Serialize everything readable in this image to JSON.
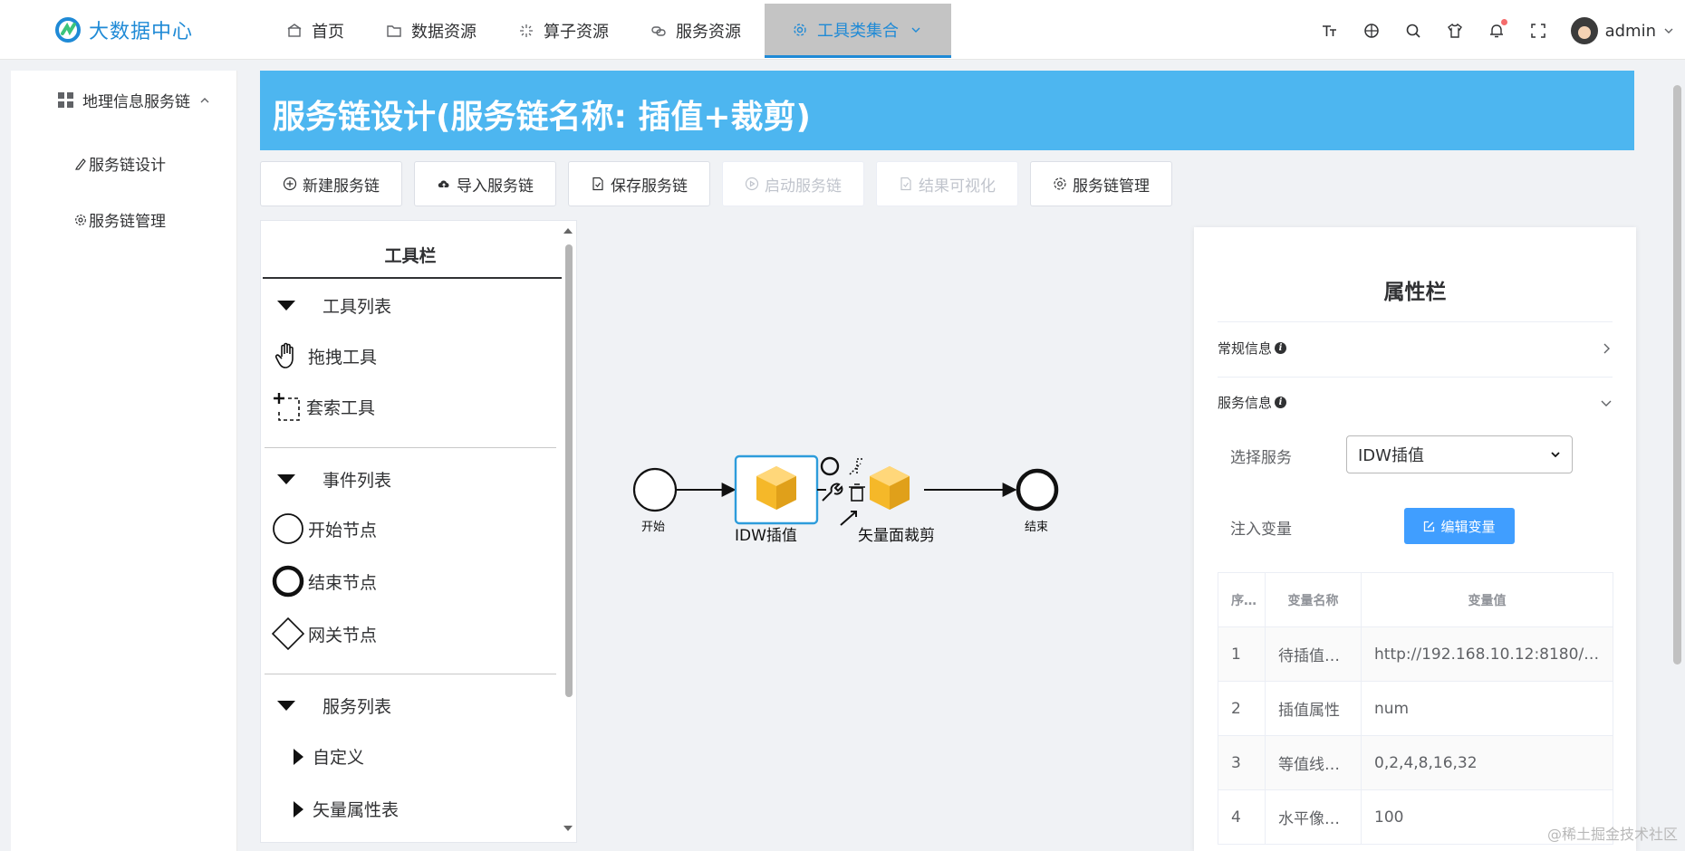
{
  "app": {
    "title": "大数据中心"
  },
  "nav": {
    "items": [
      {
        "label": "首页",
        "icon": "home-icon"
      },
      {
        "label": "数据资源",
        "icon": "folder-icon"
      },
      {
        "label": "算子资源",
        "icon": "sparkle-icon"
      },
      {
        "label": "服务资源",
        "icon": "link-icon"
      },
      {
        "label": "工具类集合",
        "icon": "gear-icon",
        "active": true
      }
    ],
    "user": "admin"
  },
  "sidebar": {
    "group": "地理信息服务链",
    "items": [
      {
        "label": "服务链设计",
        "icon": "pen-icon"
      },
      {
        "label": "服务链管理",
        "icon": "gear-icon"
      }
    ]
  },
  "banner": {
    "title": "服务链设计(服务链名称: 插值+裁剪)"
  },
  "toolbar": {
    "buttons": [
      {
        "label": "新建服务链",
        "icon": "plus-circle-icon",
        "disabled": false
      },
      {
        "label": "导入服务链",
        "icon": "cloud-upload-icon",
        "disabled": false
      },
      {
        "label": "保存服务链",
        "icon": "document-check-icon",
        "disabled": false
      },
      {
        "label": "启动服务链",
        "icon": "play-icon",
        "disabled": true
      },
      {
        "label": "结果可视化",
        "icon": "document-icon",
        "disabled": true
      },
      {
        "label": "服务链管理",
        "icon": "gear-icon",
        "disabled": false
      }
    ]
  },
  "palette": {
    "title": "工具栏",
    "sections": {
      "tools": "工具列表",
      "drag": "拖拽工具",
      "lasso": "套索工具",
      "events": "事件列表",
      "start": "开始节点",
      "end": "结束节点",
      "gateway": "网关节点",
      "services": "服务列表",
      "custom": "自定义",
      "vector_attr": "矢量属性表"
    }
  },
  "diagram": {
    "start_label": "开始",
    "end_label": "结束",
    "task1_label": "IDW插值",
    "task2_label": "矢量面裁剪"
  },
  "props": {
    "title": "属性栏",
    "general": "常规信息",
    "service_info": "服务信息",
    "select_label": "选择服务",
    "select_value": "IDW插值",
    "inject_label": "注入变量",
    "edit_button": "编辑变量",
    "table": {
      "headers": [
        "序号",
        "变量名称",
        "变量值"
      ],
      "rows": [
        [
          "1",
          "待插值数…",
          "http://192.168.10.12:8180/…"
        ],
        [
          "2",
          "插值属性",
          "num"
        ],
        [
          "3",
          "等值线数…",
          "0,2,4,8,16,32"
        ],
        [
          "4",
          "水平像素…",
          "100"
        ]
      ]
    }
  },
  "watermark": "@稀土掘金技术社区",
  "colors": {
    "accent": "#409eff",
    "banner": "#4db6f0",
    "brand": "#1f8ad6",
    "task_fill": "#f5b829"
  }
}
